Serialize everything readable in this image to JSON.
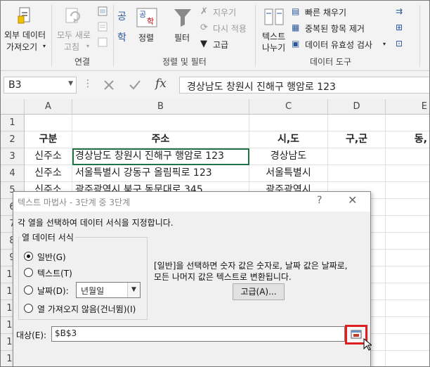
{
  "ribbon": {
    "get_data_line1": "외부 데이터",
    "get_data_line2": "가져오기",
    "refresh_line1": "모두 새로",
    "refresh_line2": "고침",
    "group_connections": "연결",
    "sort": "정렬",
    "filter": "필터",
    "clear": "지우기",
    "reapply": "다시 적용",
    "advanced": "고급",
    "group_sort_filter": "정렬 및 필터",
    "text_to_columns_line1": "텍스트",
    "text_to_columns_line2": "나누기",
    "flash_fill": "빠른 채우기",
    "remove_duplicates": "중복된 항목 제거",
    "data_validation": "데이터 유효성 검사",
    "group_data_tools": "데이터 도구",
    "sort_az_label": "공",
    "sort_ga_label": "학"
  },
  "formula_bar": {
    "name_box": "B3",
    "fx_label": "fx",
    "formula": "경상남도 창원시 진해구 행암로 123"
  },
  "grid": {
    "columns": [
      "A",
      "B",
      "C",
      "D",
      "E"
    ],
    "rows": [
      "1",
      "2",
      "3",
      "4",
      "5",
      "6",
      "7",
      "8",
      "9",
      "10",
      "11",
      "12",
      "13",
      "14",
      "15"
    ],
    "header_row": {
      "a": "구분",
      "b": "주소",
      "c": "시,도",
      "d": "구,군",
      "e": "동,"
    },
    "data_rows": [
      {
        "a": "신주소",
        "b": "경상남도 창원시 진해구 행암로 123",
        "c": "경상남도"
      },
      {
        "a": "신주소",
        "b": "서울특별시 강동구 올림픽로 123",
        "c": "서울특별시"
      },
      {
        "a": "신주소",
        "b": "광주광역시 북구 동문대로 345",
        "c": "광주광역시"
      }
    ]
  },
  "dialog": {
    "title": "텍스트 마법사 - 3단계 중 3단계",
    "help": "?",
    "close": "✕",
    "instruction": "각 열을 선택하여 데이터 서식을 지정합니다.",
    "group_label": "열 데이터 서식",
    "options": [
      "일반(G)",
      "텍스트(T)",
      "날짜(D):",
      "열 가져오지 않음(건너뜀)(I)"
    ],
    "selected_option": "일반(G)",
    "date_format": "년월일",
    "description_line1": "[일반]을 선택하면 숫자 값은 숫자로, 날짜 값은 날짜로,",
    "description_line2": "모든 나머지 값은 텍스트로 변환됩니다.",
    "advanced_button": "고급(A)...",
    "target_label": "대상(E):",
    "target_value": "$B$3"
  },
  "colors": {
    "highlight": "#e02020",
    "ribbon_bg": "#f3f3f3",
    "dialog_bg": "#f0f0f0"
  }
}
